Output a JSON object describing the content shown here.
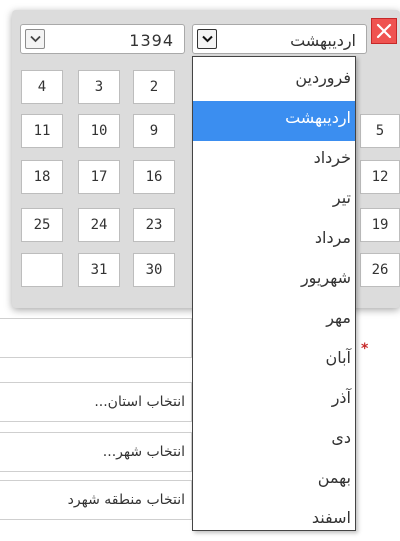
{
  "calendar": {
    "year": "1394",
    "selected_month": "اردیبهشت",
    "days_row1": [
      "2",
      "3",
      "4"
    ],
    "days_row2": [
      "9",
      "10",
      "11"
    ],
    "days_row3": [
      "16",
      "17",
      "18"
    ],
    "days_row4": [
      "23",
      "24",
      "25"
    ],
    "days_row5": [
      "30",
      "31"
    ],
    "right_column": [
      "5",
      "12",
      "19",
      "26"
    ]
  },
  "month_dropdown": {
    "options": [
      "فروردین",
      "اردیبهشت",
      "خرداد",
      "تیر",
      "مرداد",
      "شهریور",
      "مهر",
      "آبان",
      "آذر",
      "دی",
      "بهمن",
      "اسفند"
    ],
    "selected_index": 1
  },
  "form": {
    "province_placeholder": "انتخاب استان...",
    "city_placeholder": "انتخاب شهر...",
    "area_placeholder": "انتخاب منطقه شهرد",
    "required_mark": "*"
  },
  "colors": {
    "accent": "#3b8ef0",
    "close": "#ef5350"
  }
}
